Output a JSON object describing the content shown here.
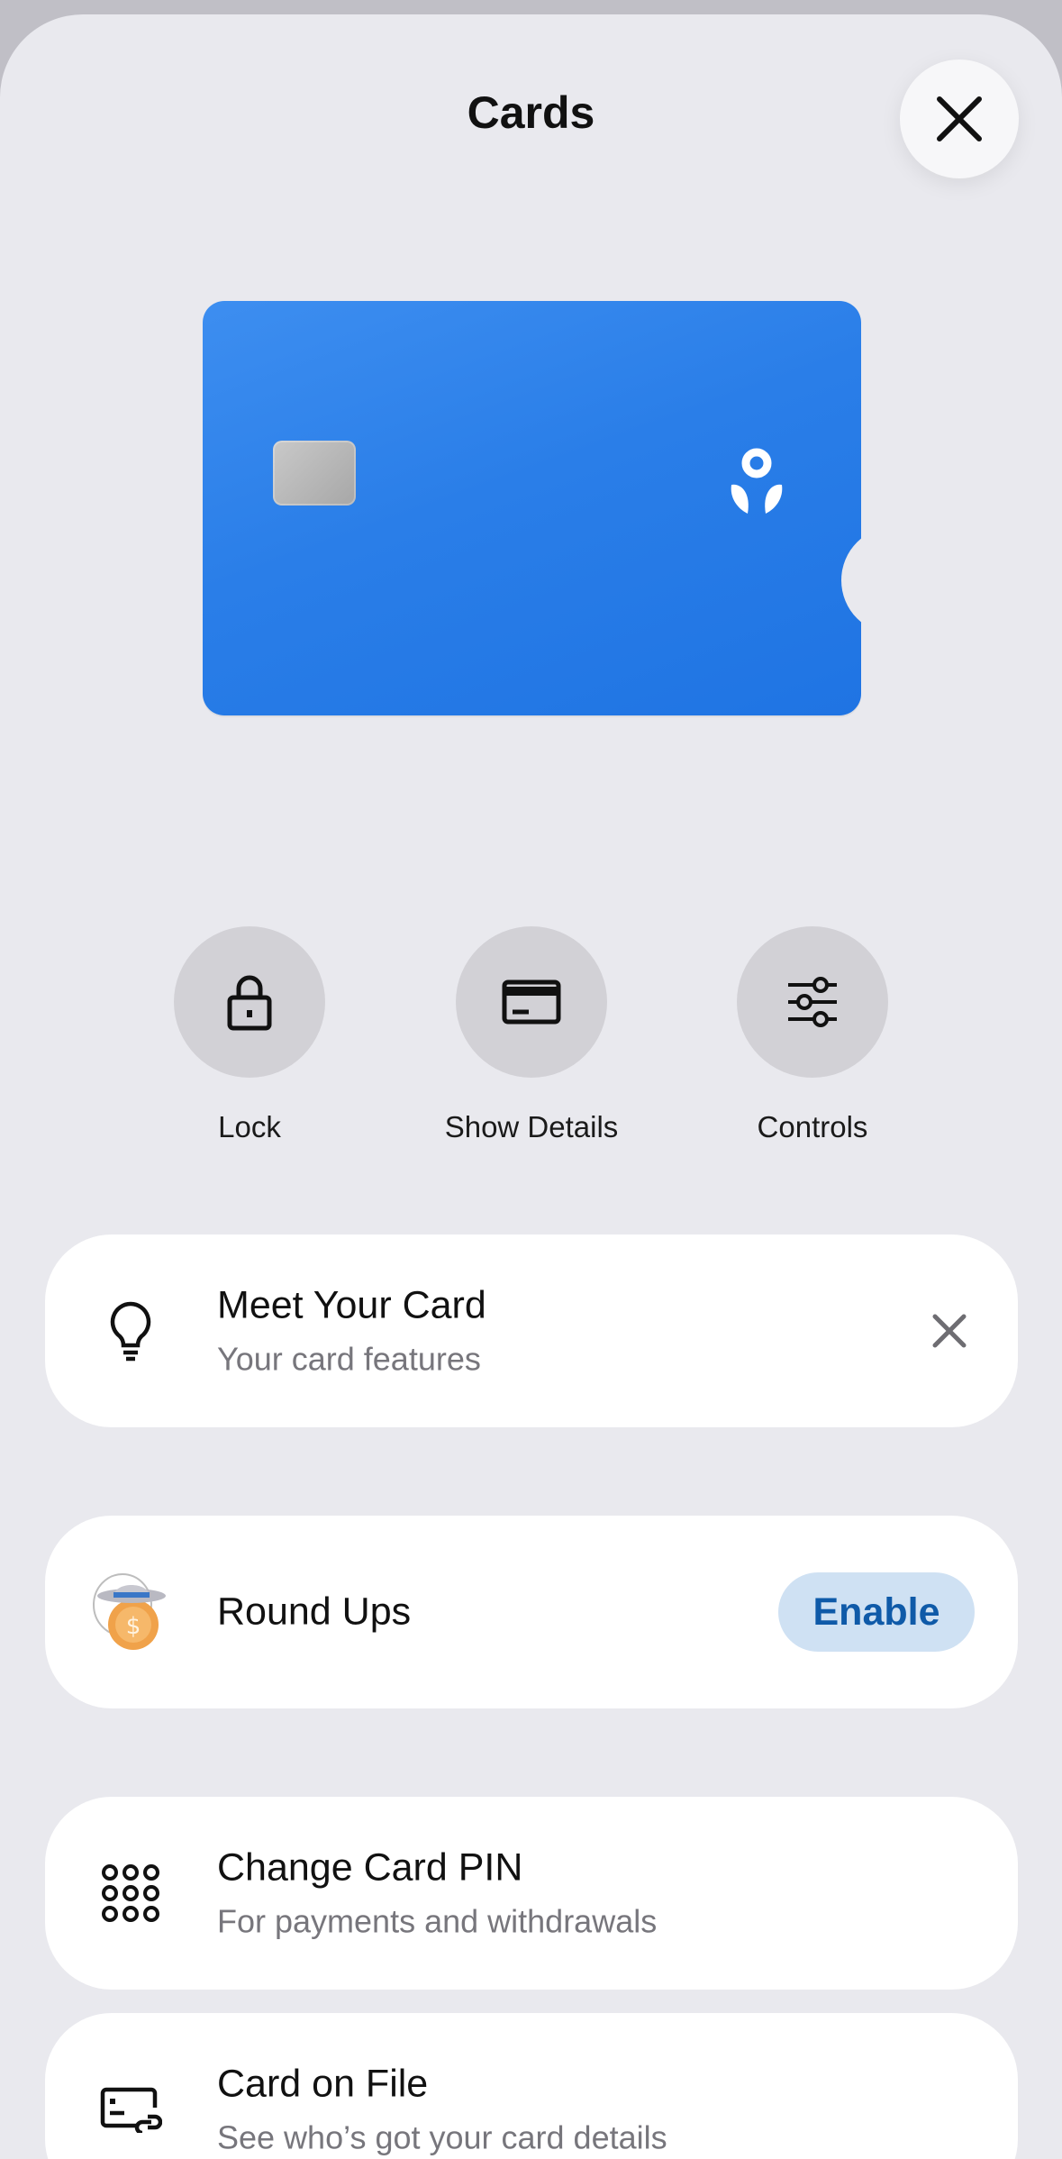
{
  "header": {
    "title": "Cards",
    "close_icon": "close-icon"
  },
  "card": {
    "color": "#2a7ee8",
    "chip_icon": "card-chip",
    "logo_icon": "bank-logo-icon"
  },
  "actions": [
    {
      "label": "Lock",
      "icon": "lock-icon"
    },
    {
      "label": "Show Details",
      "icon": "card-details-icon"
    },
    {
      "label": "Controls",
      "icon": "sliders-icon"
    }
  ],
  "list": {
    "meet_card": {
      "title": "Meet Your Card",
      "subtitle": "Your card features",
      "icon": "lightbulb-icon",
      "dismiss_icon": "close-icon"
    },
    "round_ups": {
      "title": "Round Ups",
      "button_label": "Enable",
      "icon": "round-ups-coin-icon"
    },
    "change_pin": {
      "title": "Change Card PIN",
      "subtitle": "For payments and withdrawals",
      "icon": "keypad-icon"
    },
    "card_on_file": {
      "title": "Card on File",
      "subtitle": "See who’s got your card details",
      "icon": "card-link-icon"
    }
  },
  "colors": {
    "background": "#e9e9ee",
    "card_blue": "#2a7ee8",
    "enable_bg": "#cfe1f3",
    "enable_text": "#0f5aa8",
    "action_circle": "#d2d1d6"
  }
}
